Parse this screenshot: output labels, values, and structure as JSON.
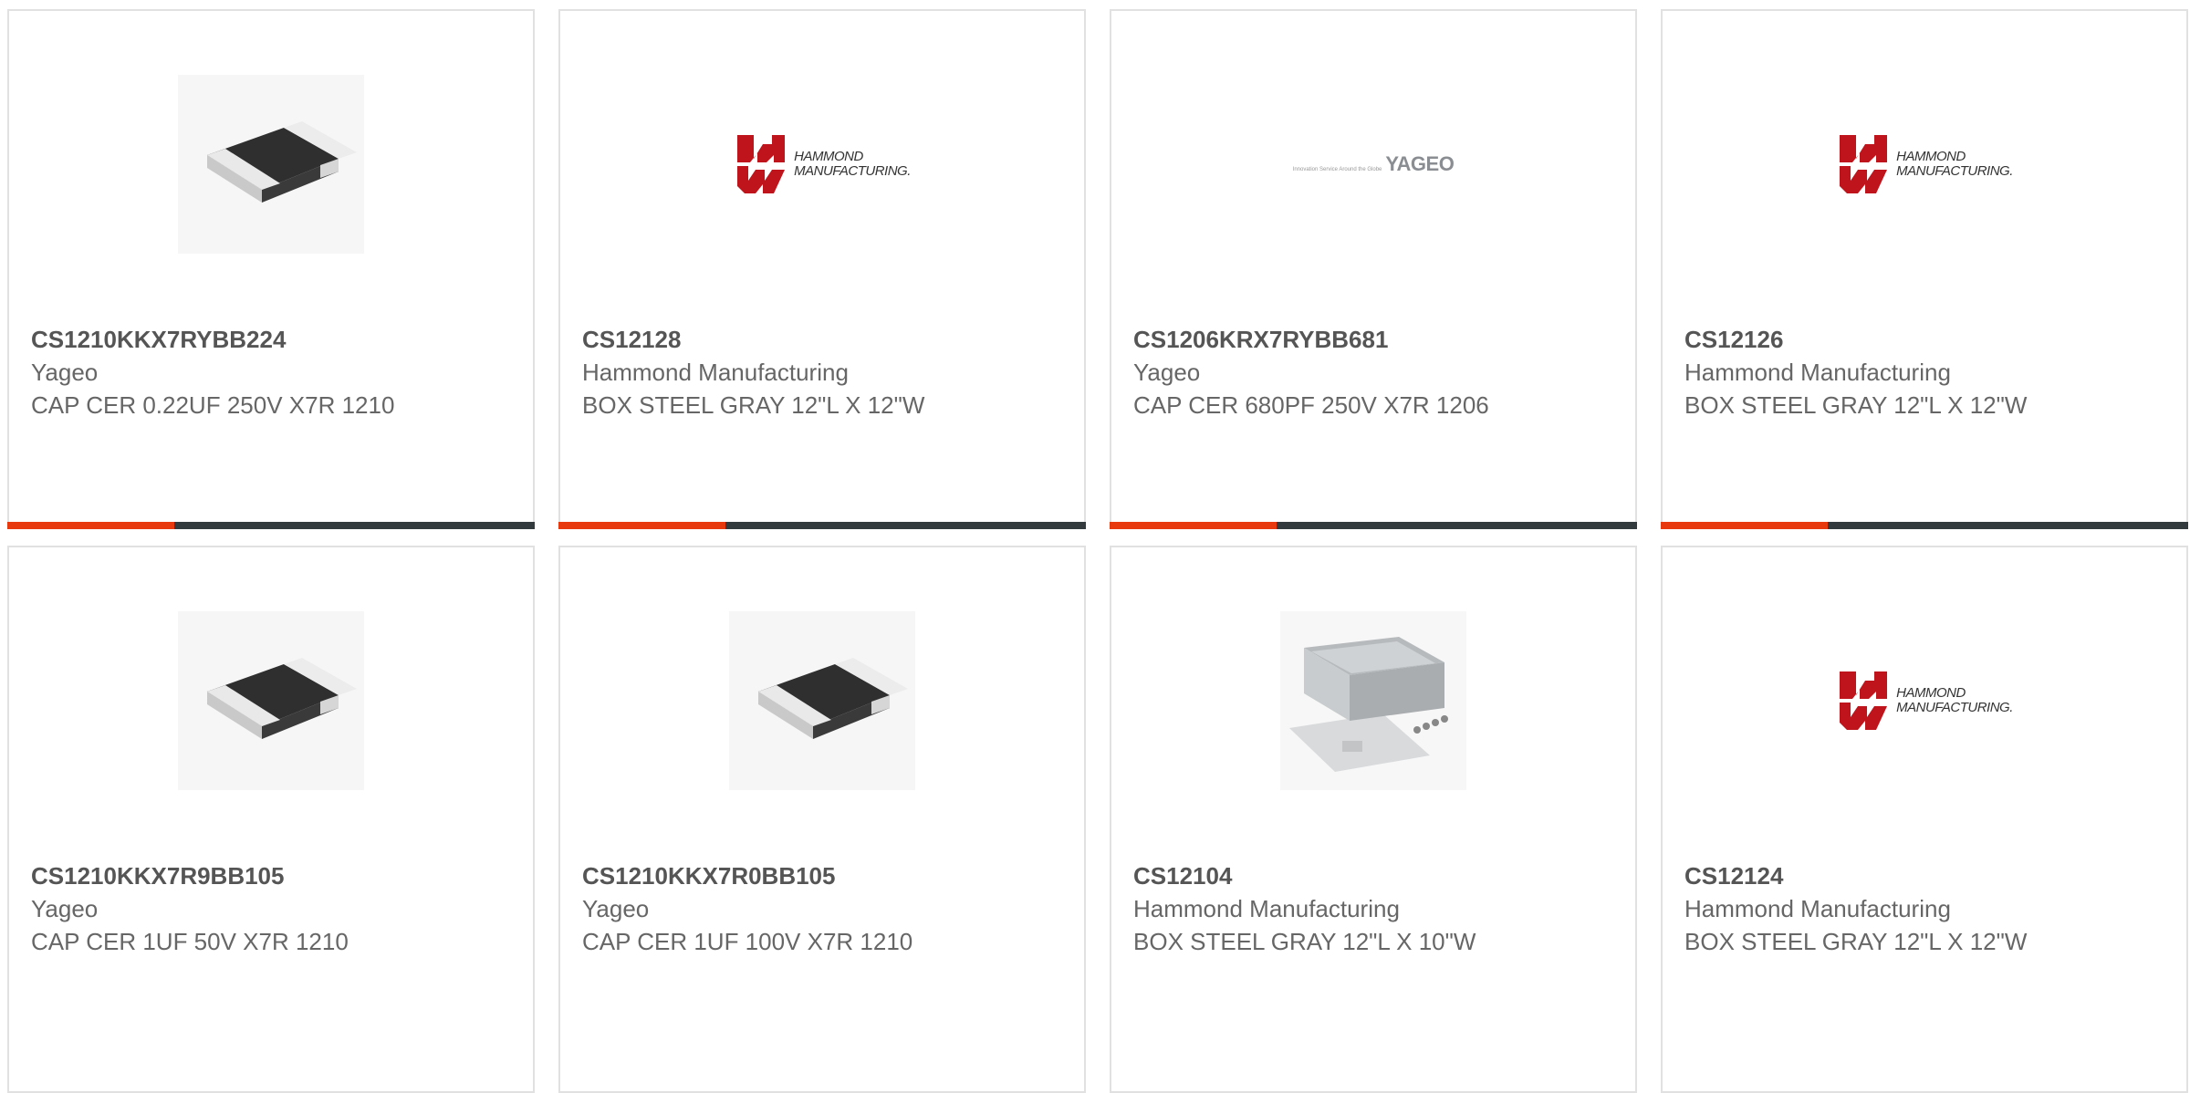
{
  "products": [
    {
      "part_number": "CS1210KKX7RYBB224",
      "manufacturer": "Yageo",
      "description": "CAP CER 0.22UF 250V X7R 1210",
      "image": "ceramic-capacitor-chip"
    },
    {
      "part_number": "CS12128",
      "manufacturer": "Hammond Manufacturing",
      "description": "BOX STEEL GRAY 12\"L X 12\"W",
      "image": "hammond-logo"
    },
    {
      "part_number": "CS1206KRX7RYBB681",
      "manufacturer": "Yageo",
      "description": "CAP CER 680PF 250V X7R 1206",
      "image": "yageo-logo"
    },
    {
      "part_number": "CS12126",
      "manufacturer": "Hammond Manufacturing",
      "description": "BOX STEEL GRAY 12\"L X 12\"W",
      "image": "hammond-logo"
    },
    {
      "part_number": "CS1210KKX7R9BB105",
      "manufacturer": "Yageo",
      "description": "CAP CER 1UF 50V X7R 1210",
      "image": "ceramic-capacitor-chip"
    },
    {
      "part_number": "CS1210KKX7R0BB105",
      "manufacturer": "Yageo",
      "description": "CAP CER 1UF 100V X7R 1210",
      "image": "ceramic-capacitor-chip"
    },
    {
      "part_number": "CS12104",
      "manufacturer": "Hammond Manufacturing",
      "description": "BOX STEEL GRAY 12\"L X 10\"W",
      "image": "steel-enclosure-box"
    },
    {
      "part_number": "CS12124",
      "manufacturer": "Hammond Manufacturing",
      "description": "BOX STEEL GRAY 12\"L X 12\"W",
      "image": "hammond-logo"
    }
  ],
  "logos": {
    "hammond_line1": "HAMMOND",
    "hammond_line2": "MANUFACTURING.",
    "yageo_tagline": "Innovation Service Around the Globe",
    "yageo_word": "YAGEO"
  },
  "colors": {
    "accent": "#e8380d",
    "bar": "#333a3e",
    "hammond_red": "#c0141c"
  }
}
